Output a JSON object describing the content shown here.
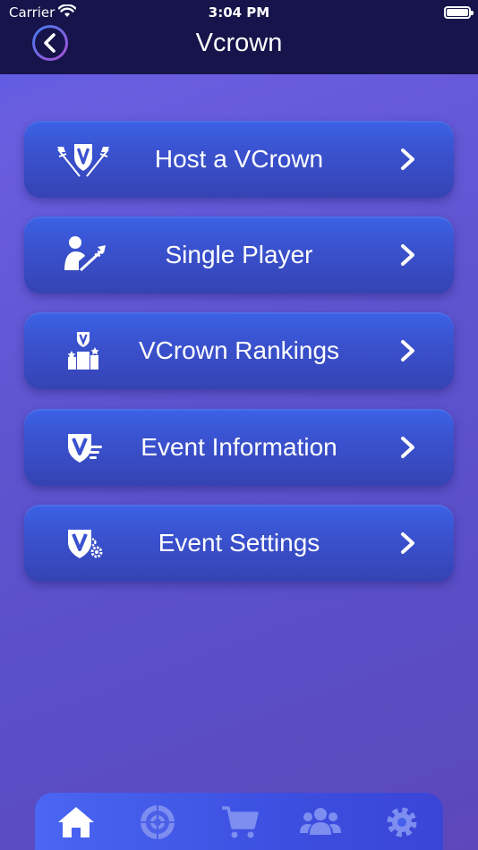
{
  "status_bar": {
    "carrier": "Carrier",
    "time": "3:04 PM"
  },
  "nav": {
    "title": "Vcrown",
    "back_icon": "chevron-left-icon"
  },
  "menu": {
    "items": [
      {
        "label": "Host a VCrown",
        "icon": "darts-crown-icon"
      },
      {
        "label": "Single Player",
        "icon": "player-dart-icon"
      },
      {
        "label": "VCrown Rankings",
        "icon": "podium-icon"
      },
      {
        "label": "Event Information",
        "icon": "shield-list-icon"
      },
      {
        "label": "Event Settings",
        "icon": "shield-gear-icon"
      }
    ]
  },
  "tabs": [
    {
      "name": "home",
      "icon": "home-icon",
      "active": true
    },
    {
      "name": "target",
      "icon": "target-icon",
      "active": false
    },
    {
      "name": "cart",
      "icon": "cart-icon",
      "active": false
    },
    {
      "name": "community",
      "icon": "people-icon",
      "active": false
    },
    {
      "name": "settings",
      "icon": "gear-icon",
      "active": false
    }
  ],
  "colors": {
    "nav_bg": "#16144a",
    "button_top": "#3b62e6",
    "button_bottom": "#3543b3",
    "tab_active": "#ffffff",
    "tab_inactive": "#7d8ef0"
  }
}
